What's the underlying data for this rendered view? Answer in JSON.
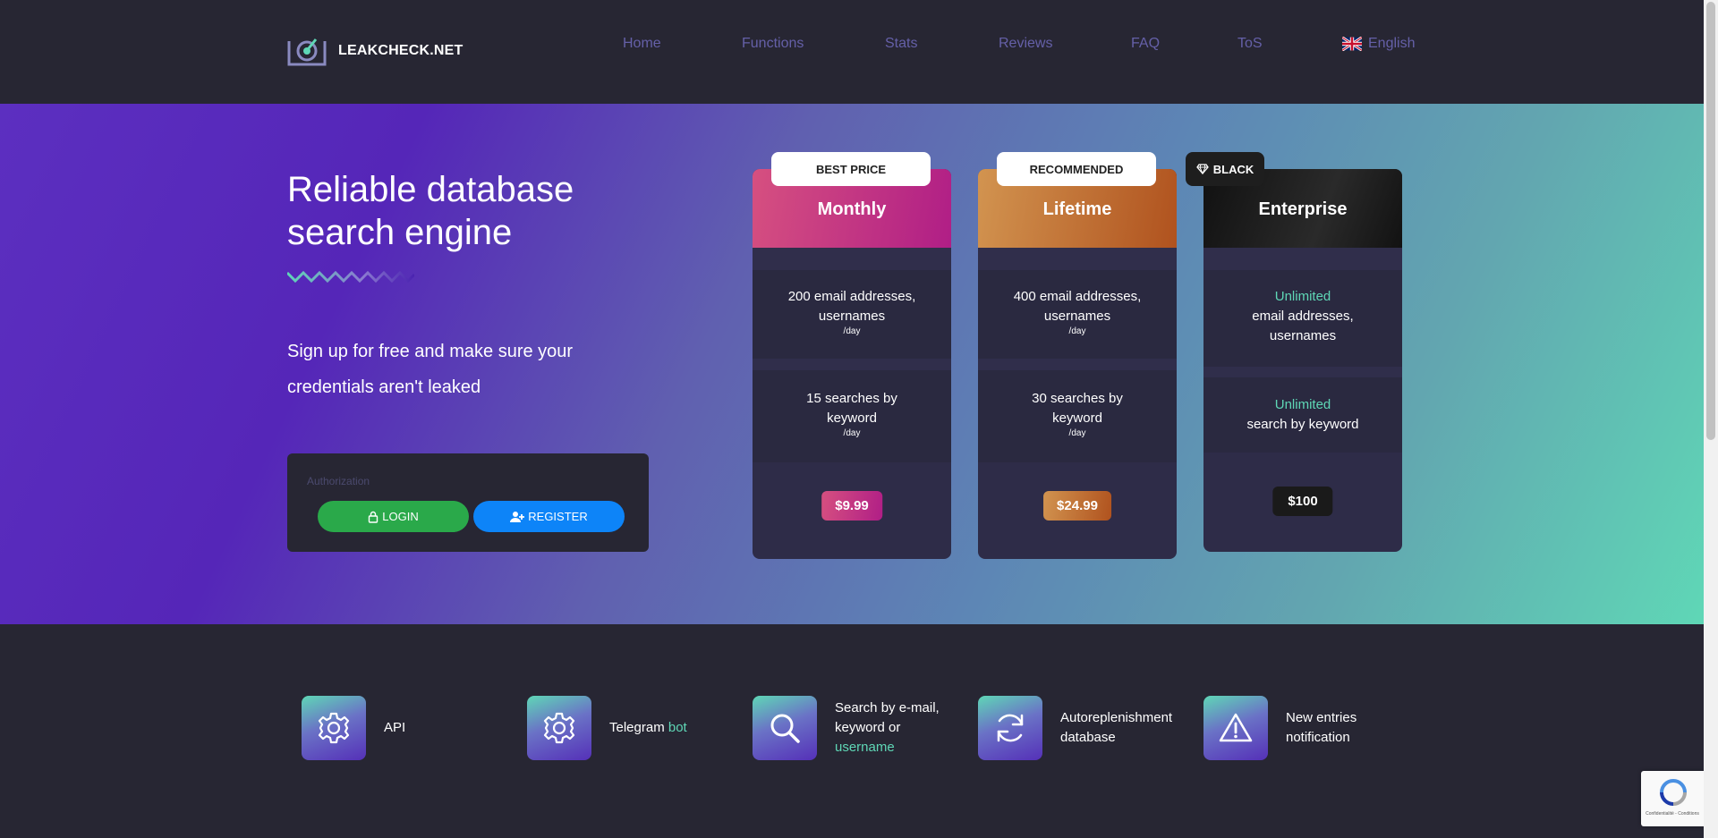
{
  "brand": {
    "name": "LEAKCHECK.NET"
  },
  "nav": {
    "items": [
      {
        "label": "Home"
      },
      {
        "label": "Functions"
      },
      {
        "label": "Stats"
      },
      {
        "label": "Reviews"
      },
      {
        "label": "FAQ"
      },
      {
        "label": "ToS"
      }
    ],
    "language": "English",
    "link_color": "#6560a8"
  },
  "hero": {
    "title": "Reliable database search engine",
    "subtitle": "Sign up for free and make sure your credentials aren't leaked"
  },
  "auth": {
    "label": "Authorization",
    "login_label": "LOGIN",
    "register_label": "REGISTER"
  },
  "plans": [
    {
      "tag": "BEST PRICE",
      "name": "Monthly",
      "feature1_main": "200 email addresses, usernames",
      "feature1_per": "/day",
      "feature2_main": "15 searches by keyword",
      "feature2_per": "/day",
      "price": "$9.99"
    },
    {
      "tag": "RECOMMENDED",
      "name": "Lifetime",
      "feature1_main": "400 email addresses, usernames",
      "feature1_per": "/day",
      "feature2_main": "30 searches by keyword",
      "feature2_per": "/day",
      "price": "$24.99"
    },
    {
      "tag": "BLACK",
      "name": "Enterprise",
      "feature1_highlight": "Unlimited",
      "feature1_main": "email addresses, usernames",
      "feature2_highlight": "Unlimited",
      "feature2_main": "search by keyword",
      "price": "$100"
    }
  ],
  "features": [
    {
      "icon": "gear-icon",
      "text": "API"
    },
    {
      "icon": "gear-icon",
      "text": "Telegram",
      "highlight": "bot"
    },
    {
      "icon": "search-icon",
      "text": "Search by e-mail, keyword or",
      "highlight": "username"
    },
    {
      "icon": "refresh-icon",
      "text": "Autoreplenishment database"
    },
    {
      "icon": "warning-icon",
      "text": "New entries notification"
    }
  ],
  "recaptcha": {
    "text": "Confidentialité - Conditions"
  },
  "colors": {
    "accent_teal": "#5fd7b6",
    "login_green": "#2aa94a",
    "register_blue": "#0d84f8",
    "background": "#272633"
  }
}
